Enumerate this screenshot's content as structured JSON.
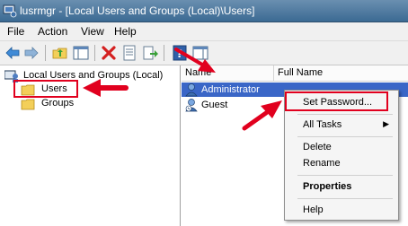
{
  "window": {
    "title": "lusrmgr - [Local Users and Groups (Local)\\Users]"
  },
  "menu": {
    "file": "File",
    "action": "Action",
    "view": "View",
    "help": "Help"
  },
  "toolbar": {
    "icons": [
      "back-arrow-icon",
      "forward-arrow-icon",
      "up-folder-icon",
      "show-hide-tree-icon",
      "delete-icon",
      "properties-icon",
      "export-list-icon",
      "help-icon",
      "show-hide-action-pane-icon"
    ]
  },
  "tree": {
    "root": "Local Users and Groups (Local)",
    "users": "Users",
    "groups": "Groups"
  },
  "list": {
    "columns": {
      "name": "Name",
      "full_name": "Full Name"
    },
    "rows": [
      {
        "name": "Administrator",
        "full_name": ""
      },
      {
        "name": "Guest",
        "full_name": ""
      }
    ]
  },
  "context_menu": {
    "set_password": "Set Password...",
    "all_tasks": "All Tasks",
    "delete": "Delete",
    "rename": "Rename",
    "properties": "Properties",
    "help": "Help"
  },
  "colors": {
    "annotation_red": "#e1001e",
    "selection_blue": "#3a66c7"
  }
}
